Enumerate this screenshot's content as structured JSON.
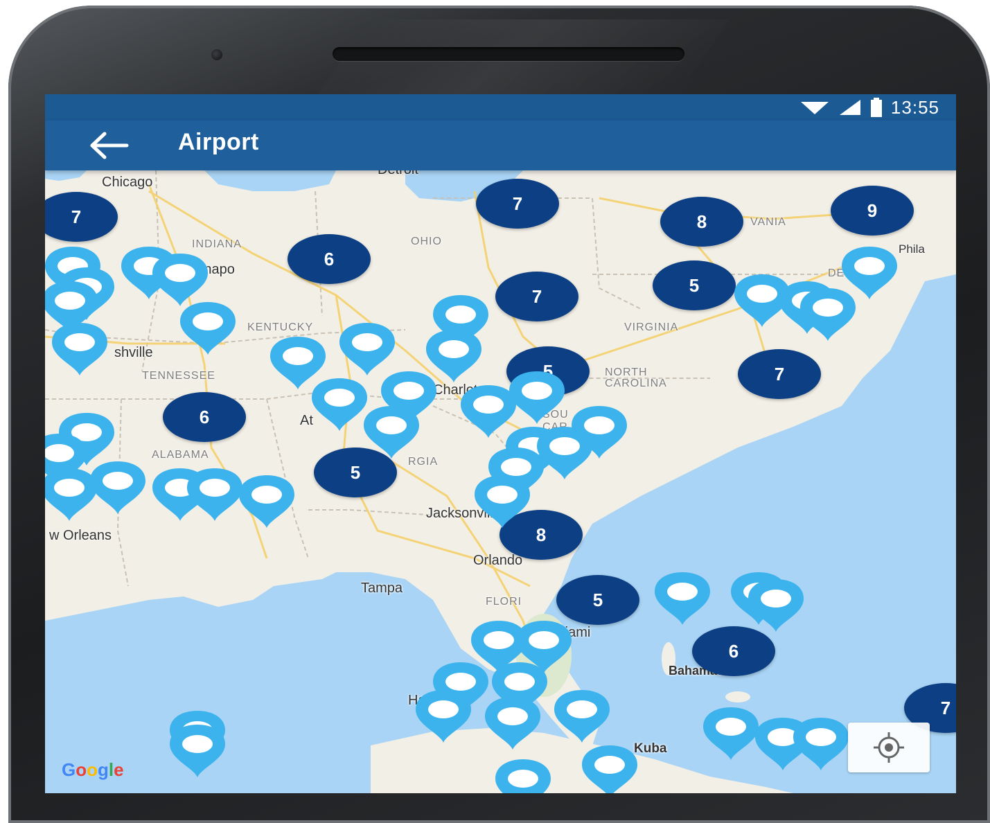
{
  "status_bar": {
    "time": "13:55"
  },
  "app_bar": {
    "back_icon": "arrow-left-icon",
    "title": "Airport"
  },
  "colors": {
    "app_bar": "#1e5f9c",
    "status_bar": "#1c5a94",
    "cluster": "#0d3f85",
    "pin": "#3db3ee",
    "water": "#a9d4f5",
    "land": "#f2efe6"
  },
  "map": {
    "place_labels": {
      "chicago": "Chicago",
      "indianapolis": "Indianapo",
      "nashville": "shville",
      "charlotte": "Charlot",
      "atlanta": "At",
      "jacksonville": "Jacksonville",
      "new_orleans": "w Orleans",
      "orlando": "Orlando",
      "tampa": "Tampa",
      "miami": "Miami",
      "bahamas": "Bahamas",
      "kuba": "Kuba",
      "havana": "Ha",
      "phila": "Phila",
      "detroit": "Detroit"
    },
    "state_labels": {
      "indiana": "INDIANA",
      "ohio": "OHIO",
      "kentucky": "KENTUCKY",
      "virginia": "VIRGINIA",
      "tennessee": "TENNESSEE",
      "north_carolina": "NORTH CAROLINA",
      "alabama": "ALABAMA",
      "georgia": "RGIA",
      "pennsylvania": "VANIA",
      "florida": "FLORI",
      "south_carolina": "SOU CAR",
      "delaware": "DELAWARE"
    },
    "cluster_counts": [
      "7",
      "7",
      "8",
      "9",
      "6",
      "7",
      "5",
      "5",
      "7",
      "6",
      "5",
      "8",
      "5",
      "6",
      "7"
    ],
    "pin_icon": "map-pin-icon",
    "attribution": "Google",
    "locate_icon": "my-location-icon"
  }
}
